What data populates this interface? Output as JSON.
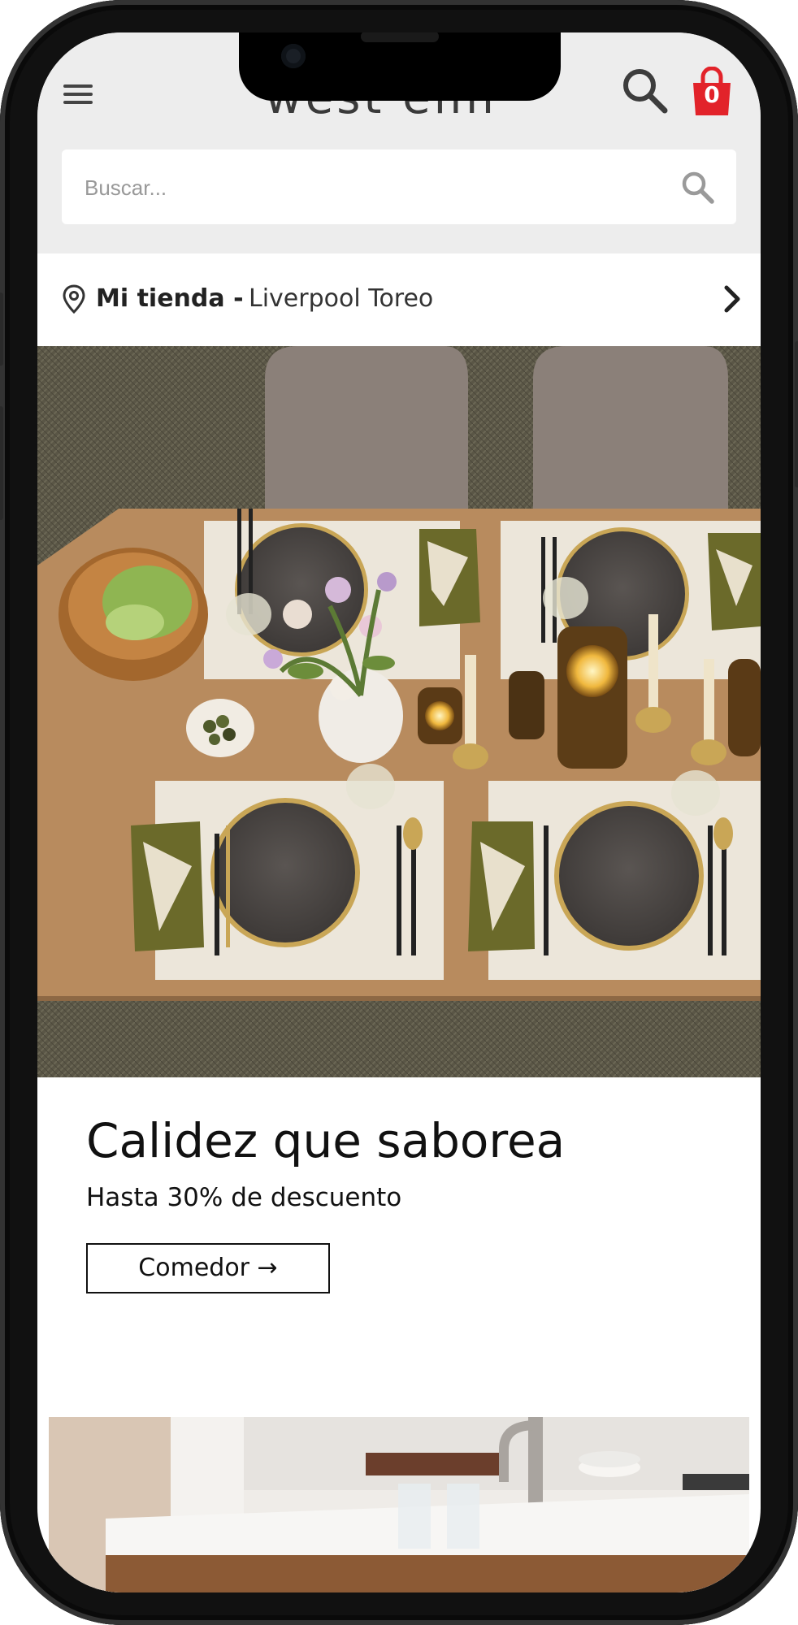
{
  "header": {
    "logo_text": "west elm",
    "bag_count": "0",
    "accent_color": "#e2232a"
  },
  "search": {
    "placeholder": "Buscar..."
  },
  "store": {
    "label": "Mi tienda -",
    "name": "Liverpool Toreo"
  },
  "promo": {
    "title": "Calidez que saborea",
    "subtitle": "Hasta 30% de descuento",
    "cta_label": "Comedor →"
  },
  "icons": {
    "menu": "hamburger-menu-icon",
    "search": "search-icon",
    "bag": "shopping-bag-icon",
    "pin": "map-pin-icon",
    "chevron": "chevron-right-icon"
  }
}
